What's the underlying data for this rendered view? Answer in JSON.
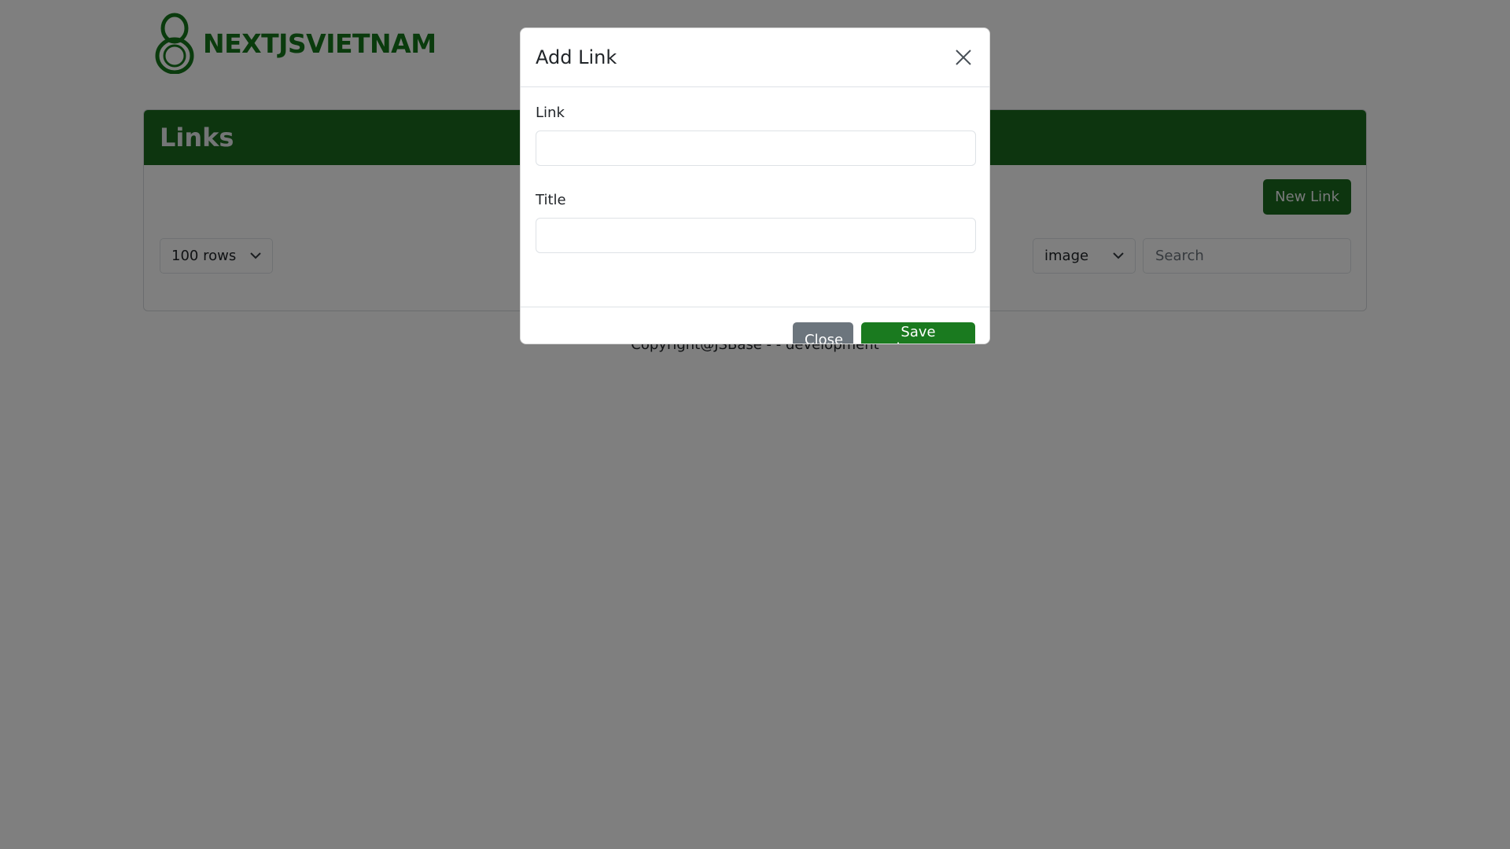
{
  "brand": {
    "name": "NEXTJSVIETNAM",
    "logo_icon": "figure-eight-logo-icon",
    "color": "#15771a"
  },
  "card": {
    "title": "Links",
    "new_link_label": "New Link",
    "rows_select_value": "100 rows",
    "type_select_value": "image",
    "search_placeholder": "Search"
  },
  "footer": {
    "text": "Copyright@JSBase - - development"
  },
  "modal": {
    "title": "Add Link",
    "close_icon": "close-icon",
    "fields": [
      {
        "label": "Link",
        "value": ""
      },
      {
        "label": "Title",
        "value": ""
      }
    ],
    "close_label": "Close",
    "save_label": "Save changes"
  },
  "colors": {
    "accent": "#1a6b1e",
    "secondary": "#6c757d",
    "backdrop": "rgba(0,0,0,0.5)"
  }
}
